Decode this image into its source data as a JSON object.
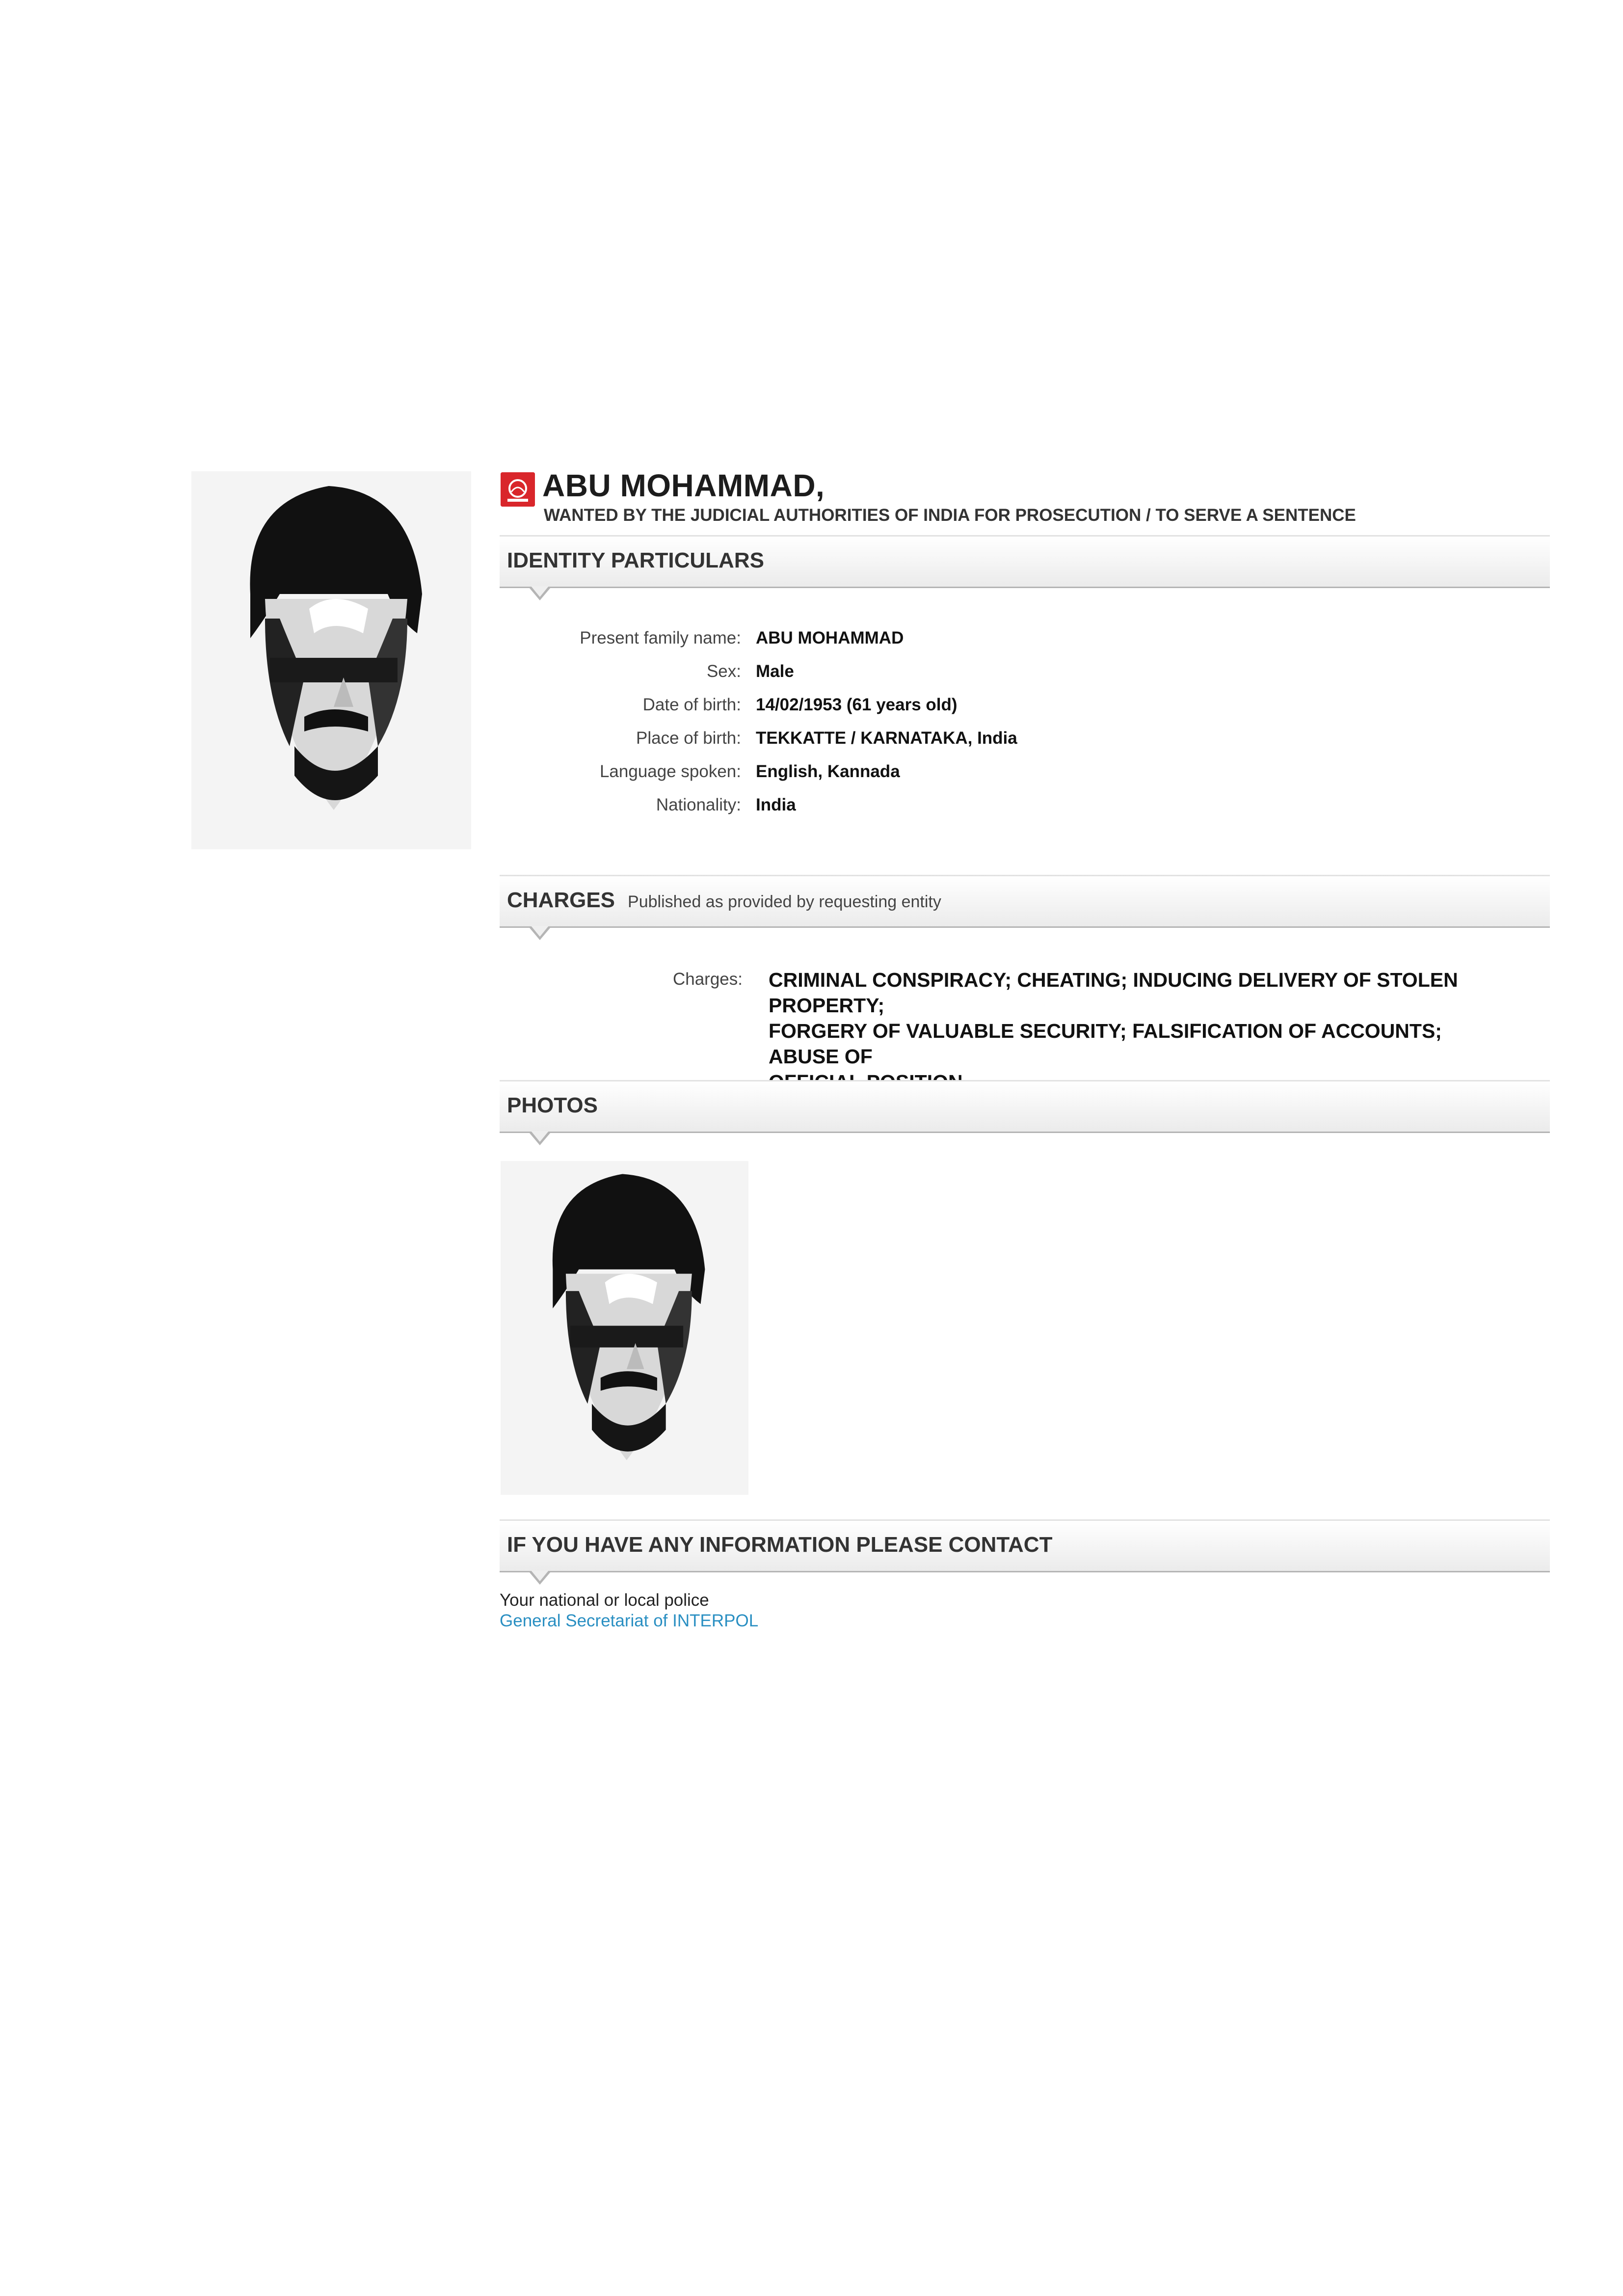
{
  "header": {
    "name": "ABU MOHAMMAD,",
    "subtitle": "WANTED BY THE JUDICIAL AUTHORITIES OF INDIA FOR PROSECUTION / TO SERVE A SENTENCE",
    "icon": "interpol-red-notice-icon"
  },
  "identity": {
    "title": "IDENTITY PARTICULARS",
    "rows": [
      {
        "label": "Present family name:",
        "value": "ABU MOHAMMAD"
      },
      {
        "label": "Sex:",
        "value": "Male"
      },
      {
        "label": "Date of birth:",
        "value": "14/02/1953 (61 years old)"
      },
      {
        "label": "Place of birth:",
        "value": "TEKKATTE / KARNATAKA, India"
      },
      {
        "label": "Language spoken:",
        "value": "English, Kannada"
      },
      {
        "label": "Nationality:",
        "value": "India"
      }
    ]
  },
  "charges": {
    "title": "CHARGES",
    "note": "Published as provided by requesting entity",
    "label": "Charges:",
    "lines": [
      "CRIMINAL CONSPIRACY; CHEATING; INDUCING DELIVERY OF STOLEN PROPERTY;",
      "FORGERY OF VALUABLE SECURITY; FALSIFICATION OF ACCOUNTS; ABUSE OF",
      "OFFICIAL POSITION"
    ]
  },
  "photos": {
    "title": "PHOTOS"
  },
  "contact": {
    "title": "IF YOU HAVE ANY INFORMATION PLEASE CONTACT",
    "line1": "Your national or local police",
    "link": "General Secretariat of INTERPOL"
  },
  "colors": {
    "link": "#2a8fc2",
    "notice_red": "#d9262b"
  }
}
